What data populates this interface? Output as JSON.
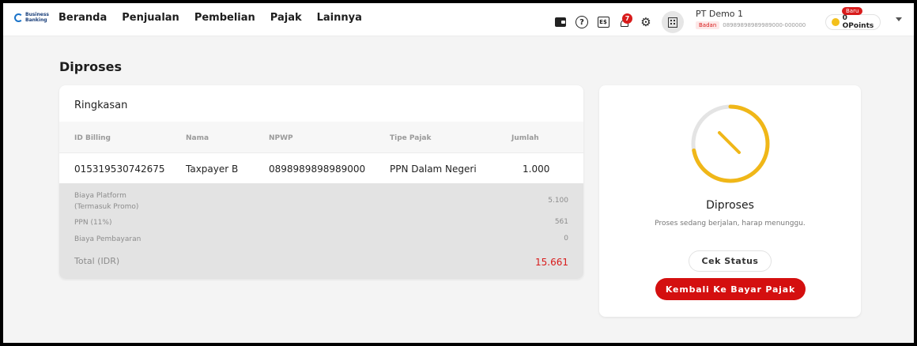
{
  "brand": {
    "line1": "Business",
    "line2": "Banking"
  },
  "nav": [
    "Beranda",
    "Penjualan",
    "Pembelian",
    "Pajak",
    "Lainnya"
  ],
  "header": {
    "notification_count": "7",
    "receipt_glyph": "E$",
    "company_name": "PT Demo 1",
    "entity_type": "Badan",
    "company_npwp": "08989898989989000-000000",
    "points_badge": "Baru",
    "points_label": "0 OPoints"
  },
  "page": {
    "title": "Diproses"
  },
  "summary": {
    "title": "Ringkasan",
    "columns": [
      "ID Billing",
      "Nama",
      "NPWP",
      "Tipe Pajak",
      "Jumlah"
    ],
    "row": {
      "id_billing": "015319530742675",
      "nama": "Taxpayer B",
      "npwp": "0898989898989000",
      "tipe_pajak": "PPN Dalam Negeri",
      "jumlah": "1.000"
    },
    "fees": [
      {
        "label_line1": "Biaya Platform",
        "label_line2": "(Termasuk Promo)",
        "value": "5.100"
      },
      {
        "label": "PPN (11%)",
        "value": "561"
      },
      {
        "label": "Biaya Pembayaran",
        "value": "0"
      }
    ],
    "total_label": "Total (IDR)",
    "total_value": "15.661"
  },
  "status": {
    "title": "Diproses",
    "description": "Proses sedang berjalan, harap menunggu.",
    "check_button": "Cek Status",
    "back_button": "Kembali Ke Bayar Pajak",
    "progress_fraction": 0.72
  },
  "colors": {
    "accent": "#d40f0f",
    "spinner": "#f0b718",
    "spinner_track": "#e4e4e4"
  }
}
